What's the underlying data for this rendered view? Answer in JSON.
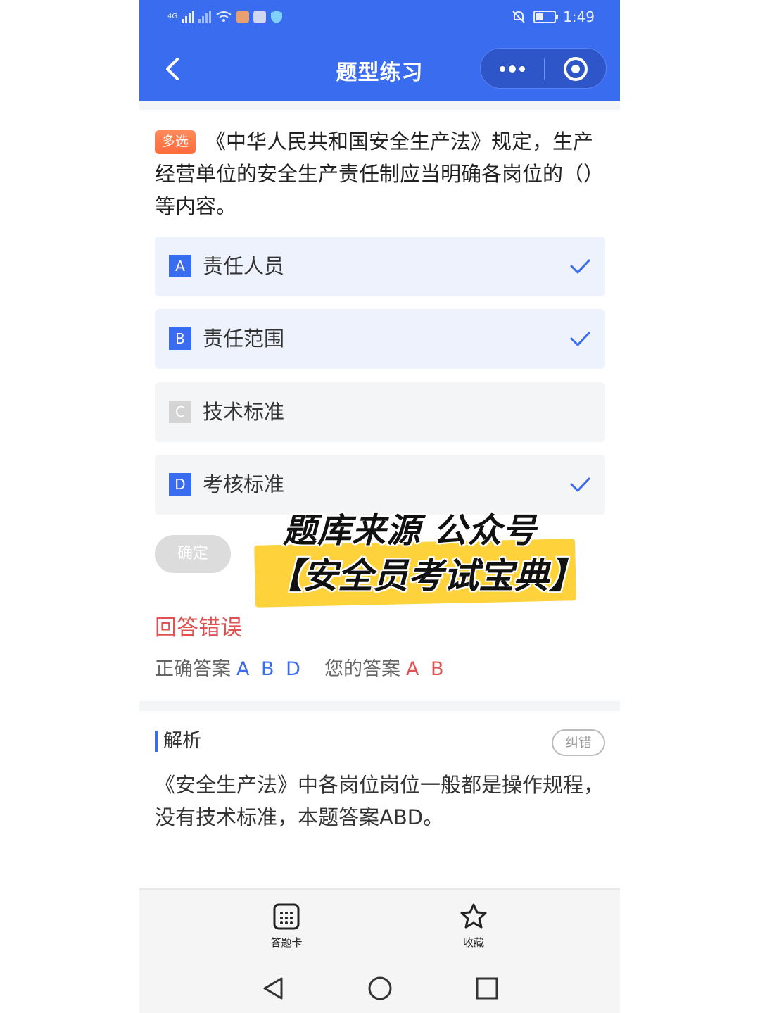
{
  "status_bar": {
    "signal_label": "4G",
    "time": "1:49"
  },
  "header": {
    "title": "题型练习"
  },
  "question": {
    "type_tag": "多选",
    "text": "《中华人民共和国安全生产法》规定，生产经营单位的安全生产责任制应当明确各岗位的（）等内容。"
  },
  "options": [
    {
      "letter": "A",
      "text": "责任人员",
      "selected": true
    },
    {
      "letter": "B",
      "text": "责任范围",
      "selected": true
    },
    {
      "letter": "C",
      "text": "技术标准",
      "selected": false
    },
    {
      "letter": "D",
      "text": "考核标准",
      "selected": true
    }
  ],
  "confirm_label": "确定",
  "watermark": {
    "line1": "题库来源 公众号",
    "line2": "【安全员考试宝典】"
  },
  "result": {
    "status": "回答错误",
    "correct_label": "正确答案",
    "correct_value": "A B D",
    "yours_label": "您的答案",
    "yours_value": "A B"
  },
  "analysis": {
    "title": "解析",
    "report_label": "纠错",
    "text": "《安全生产法》中各岗位岗位一般都是操作规程，没有技术标准，本题答案ABD。"
  },
  "tabs": {
    "card_label": "答题卡",
    "favorite_label": "收藏"
  },
  "colors": {
    "primary": "#3a6cf0",
    "error": "#e05252",
    "tag": "#ff7043",
    "highlight": "#fdd23a"
  }
}
